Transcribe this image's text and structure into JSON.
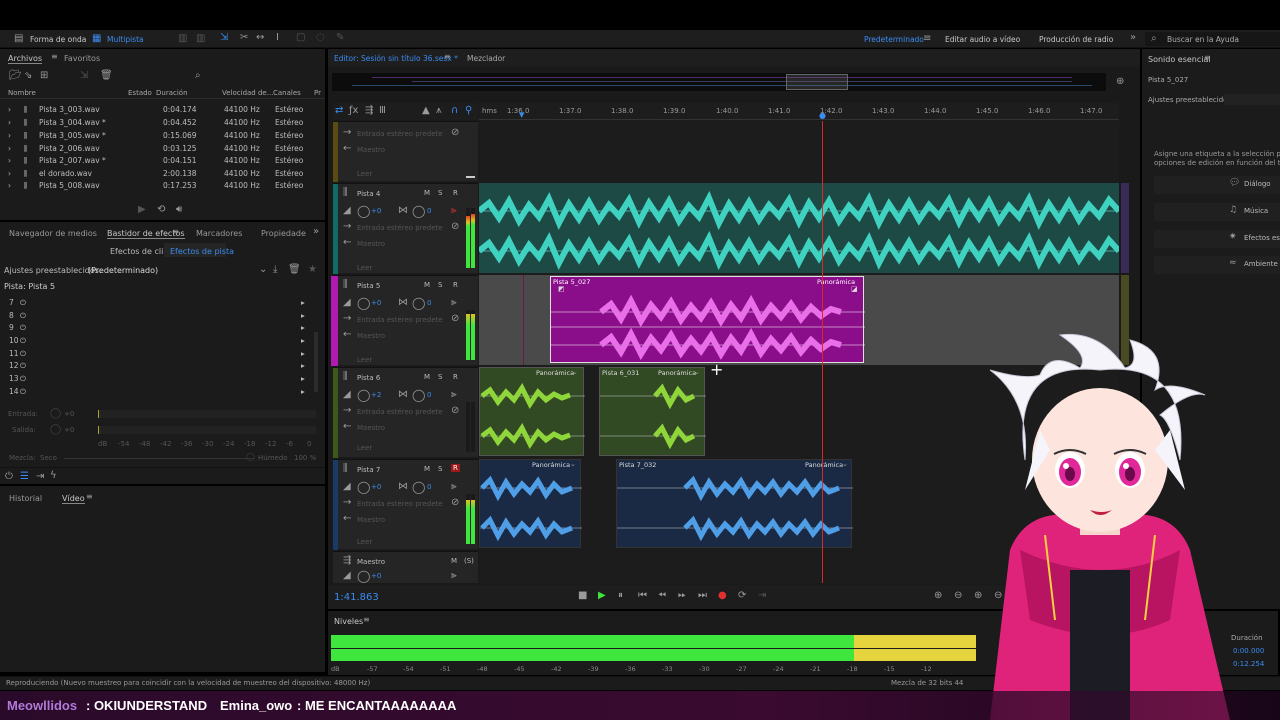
{
  "toolbar": {
    "forma_onda": "Forma de onda",
    "multipista": "Multipista",
    "workspace_predeterminado": "Predeterminado",
    "workspace_editar_video": "Editar audio a vídeo",
    "workspace_radio": "Producción de radio",
    "search_placeholder": "Buscar en la Ayuda"
  },
  "files_panel": {
    "tab_archivos": "Archivos",
    "tab_favoritos": "Favoritos",
    "columns": [
      "Nombre",
      "Estado",
      "Duración",
      "Velocidad de...",
      "Canales",
      "Pr"
    ],
    "rows": [
      {
        "name": "Pista 3_003.wav",
        "dur": "0:04.174",
        "rate": "44100 Hz",
        "ch": "Estéreo"
      },
      {
        "name": "Pista 3_004.wav *",
        "dur": "0:04.452",
        "rate": "44100 Hz",
        "ch": "Estéreo"
      },
      {
        "name": "Pista 3_005.wav *",
        "dur": "0:15.069",
        "rate": "44100 Hz",
        "ch": "Estéreo"
      },
      {
        "name": "Pista 2_006.wav",
        "dur": "0:03.125",
        "rate": "44100 Hz",
        "ch": "Estéreo"
      },
      {
        "name": "Pista 2_007.wav *",
        "dur": "0:04.151",
        "rate": "44100 Hz",
        "ch": "Estéreo"
      },
      {
        "name": "el dorado.wav",
        "dur": "2:00.138",
        "rate": "44100 Hz",
        "ch": "Estéreo"
      },
      {
        "name": "Pista 5_008.wav",
        "dur": "0:17.253",
        "rate": "44100 Hz",
        "ch": "Estéreo"
      }
    ]
  },
  "effects_panel": {
    "tab_navegador": "Navegador de medios",
    "tab_bastidor": "Bastidor de efectos",
    "tab_marcadores": "Marcadores",
    "tab_propiedades": "Propiedade",
    "sub_clip": "Efectos de clip",
    "sub_pista": "Efectos de pista",
    "ajustes_label": "Ajustes preestablecidos:",
    "ajustes_value": "(Predeterminado)",
    "pista_label": "Pista: Pista 5",
    "slots": [
      "7",
      "8",
      "9",
      "10",
      "11",
      "12",
      "13",
      "14"
    ],
    "entrada": "Entrada:",
    "salida": "Salida:",
    "mezcla": "Mezcla:",
    "seco": "Seco",
    "humedo": "Húmedo",
    "pct": "100 %",
    "db_scale": [
      "dB",
      "-54",
      "-48",
      "-42",
      "-36",
      "-30",
      "-24",
      "-18",
      "-12",
      "-6",
      "0"
    ]
  },
  "history_panel": {
    "tab_historial": "Historial",
    "tab_video": "Vídeo"
  },
  "editor": {
    "tab_editor": "Editor: Sesión sin título 36.sesx *",
    "tab_mezclador": "Mezclador",
    "ruler": [
      "hms",
      "1:36.0",
      "1:37.0",
      "1:38.0",
      "1:39.0",
      "1:40.0",
      "1:41.0",
      "1:42.0",
      "1:43.0",
      "1:44.0",
      "1:45.0",
      "1:46.0",
      "1:47.0"
    ],
    "time": "1:41.863",
    "tracks": [
      {
        "name": "Pista 4",
        "vol": "+0",
        "pan": "0"
      },
      {
        "name": "Pista 5",
        "vol": "+0",
        "pan": "0"
      },
      {
        "name": "Pista 6",
        "vol": "+2",
        "pan": "0"
      },
      {
        "name": "Pista 7",
        "vol": "+0",
        "pan": "0"
      },
      {
        "name": "Maestro",
        "vol": "+0",
        "pan": ""
      }
    ],
    "labels": {
      "entrada": "Entrada estéreo predete",
      "maestro": "Maestro",
      "leer": "Leer",
      "m": "M",
      "s": "S",
      "r": "R"
    },
    "clips": {
      "pista5": "Pista 5_027",
      "panoramica": "Panorámica",
      "pista6": "Pista 6_031",
      "pista7": "Pista 7_032"
    }
  },
  "essential_sound": {
    "title": "Sonido esencial",
    "clip_name": "Pista 5_027",
    "ajustes": "Ajustes preestablecido:",
    "desc1": "Asigne una etiqueta a la selección para",
    "desc2": "opciones de edición en función del tip",
    "options": [
      "Diálogo",
      "Música",
      "Efectos esp",
      "Ambiente"
    ],
    "duracion_label": "Duración",
    "dur1": "0:00.000",
    "dur2": "0:12.254"
  },
  "levels": {
    "title": "Niveles",
    "scale": [
      "dB",
      "-57",
      "-54",
      "-51",
      "-48",
      "-45",
      "-42",
      "-39",
      "-36",
      "-33",
      "-30",
      "-27",
      "-24",
      "-21",
      "-18",
      "-15",
      "-12"
    ]
  },
  "status": {
    "left": "Reproduciendo (Nuevo muestreo para coincidir con la velocidad de muestreo del dispositivo: 48000 Hz)",
    "right": "Mezcla de 32 bits 44"
  },
  "chat": [
    {
      "user": "Meowllidos",
      "msg": ": OKIUNDERSTAND"
    },
    {
      "user": "Emina_owo",
      "msg": ": ME ENCANTAAAAAAAA"
    }
  ],
  "colors": {
    "teal": "#3fd2c0",
    "magenta": "#8a0d8a",
    "magenta_wave": "#e86fe8",
    "green_wave": "#8fd63a",
    "blue_wave": "#4f9ee8",
    "meter_green": "#3ee63e",
    "meter_yellow": "#e6d43e",
    "chat_user": "#b07ad8",
    "playhead": "#d8282a",
    "accent": "#3b8cf0"
  }
}
